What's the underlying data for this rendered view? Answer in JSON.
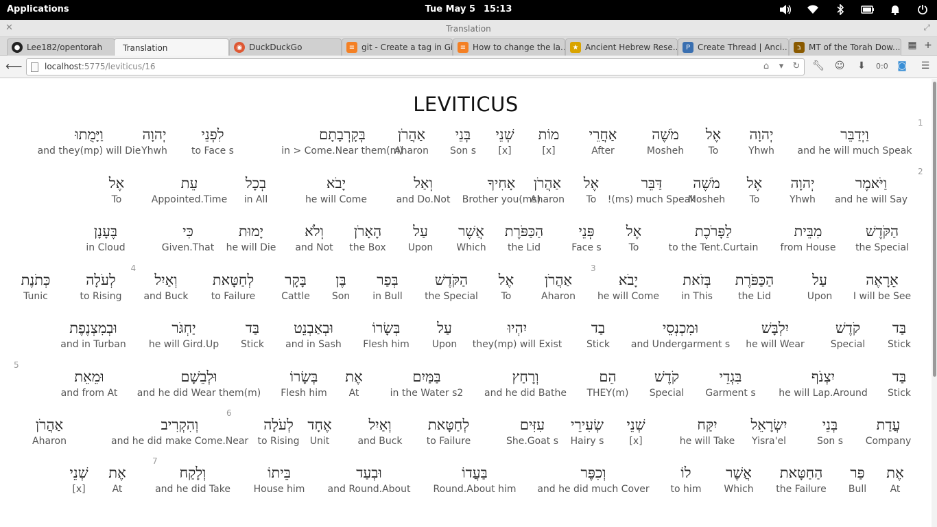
{
  "panel": {
    "applications_label": "Applications",
    "date": "Tue May  5",
    "time": "15:13",
    "icons": [
      "volume-icon",
      "wifi-icon",
      "bluetooth-icon",
      "battery-icon",
      "notifications-icon",
      "power-icon"
    ]
  },
  "window": {
    "title": "Translation"
  },
  "tabs": [
    {
      "label": "Lee182/opentorah",
      "icon": "github-icon",
      "color": "#222222",
      "active": false
    },
    {
      "label": "Translation",
      "icon": "none",
      "color": "#f6f6f6",
      "active": true
    },
    {
      "label": "DuckDuckGo",
      "icon": "duckduckgo-icon",
      "color": "#de5833",
      "active": false
    },
    {
      "label": "git - Create a tag in Gi...",
      "icon": "stackoverflow-icon",
      "color": "#f48024",
      "active": false
    },
    {
      "label": "How to change the la...",
      "icon": "stackoverflow-icon",
      "color": "#f48024",
      "active": false
    },
    {
      "label": "Ancient Hebrew Rese...",
      "icon": "star-icon",
      "color": "#d9a400",
      "active": false
    },
    {
      "label": "Create Thread | Anci...",
      "icon": "forum-icon",
      "color": "#3a6fb0",
      "active": false
    },
    {
      "label": "MT of the Torah Dow...",
      "icon": "book-icon",
      "color": "#8a5a00",
      "active": false
    }
  ],
  "url": {
    "host": "localhost",
    "path": ":5775/leviticus/16"
  },
  "toolbar": {
    "counter": "0:0"
  },
  "book_title": "LEVITICUS",
  "rows": [
    {
      "verse_marks": [
        {
          "num": "1",
          "after": 0
        }
      ],
      "words": [
        {
          "heb": "וַיְדַבֵּר",
          "eng": "and he will much Speak"
        },
        {
          "heb": "יְהוָה",
          "eng": "Yhwh"
        },
        {
          "heb": "אֶל",
          "eng": "To"
        },
        {
          "heb": "מֹשֶׁה",
          "eng": "Mosheh"
        },
        {
          "heb": "אַחֲרֵי",
          "eng": "After"
        },
        {
          "heb": "מוֹת",
          "eng": "[x]"
        },
        {
          "heb": "שְׁנֵי",
          "eng": "[x]"
        },
        {
          "heb": "בְּנֵי",
          "eng": "Son s"
        },
        {
          "heb": "אַהֲרֹן",
          "eng": "Aharon"
        },
        {
          "heb": "בְּקָרְבָתָם",
          "eng": "in > Come.Near them(m)"
        },
        {
          "heb": "לִפְנֵי",
          "eng": "to Face s"
        },
        {
          "heb": "יְהוָה",
          "eng": "Yhwh"
        },
        {
          "heb": "וַיָּמֻתוּ",
          "eng": "and they(mp) will Die"
        }
      ]
    },
    {
      "verse_marks": [
        {
          "num": "2",
          "after": 0
        }
      ],
      "words": [
        {
          "heb": "וַיֹּאמֶר",
          "eng": "and he will Say"
        },
        {
          "heb": "יְהוָה",
          "eng": "Yhwh"
        },
        {
          "heb": "אֶל",
          "eng": "To"
        },
        {
          "heb": "מֹשֶׁה",
          "eng": "Mosheh"
        },
        {
          "heb": "דַּבֵּר",
          "eng": "!(ms) much Speak"
        },
        {
          "heb": "אֶל",
          "eng": "To"
        },
        {
          "heb": "אַהֲרֹן",
          "eng": "Aharon"
        },
        {
          "heb": "אָחִיךָ",
          "eng": "Brother you(ms)"
        },
        {
          "heb": "וְאַל",
          "eng": "and Do.Not"
        },
        {
          "heb": "יָבֹא",
          "eng": "he will Come"
        },
        {
          "heb": "בְכָל",
          "eng": "in All"
        },
        {
          "heb": "עֵת",
          "eng": "Appointed.Time"
        },
        {
          "heb": "אֶל",
          "eng": "To"
        }
      ]
    },
    {
      "verse_marks": [],
      "words": [
        {
          "heb": "הַקֹּדֶשׁ",
          "eng": "the Special"
        },
        {
          "heb": "מִבֵּית",
          "eng": "from House"
        },
        {
          "heb": "לַפָּרֹכֶת",
          "eng": "to the Tent.Curtain"
        },
        {
          "heb": "אֶל",
          "eng": "To"
        },
        {
          "heb": "פְּנֵי",
          "eng": "Face s"
        },
        {
          "heb": "הַכַּפֹּרֶת",
          "eng": "the Lid"
        },
        {
          "heb": "אֲשֶׁר",
          "eng": "Which"
        },
        {
          "heb": "עַל",
          "eng": "Upon"
        },
        {
          "heb": "הָאָרֹן",
          "eng": "the Box"
        },
        {
          "heb": "וְלֹא",
          "eng": "and Not"
        },
        {
          "heb": "יָמוּת",
          "eng": "he will Die"
        },
        {
          "heb": "כִּי",
          "eng": "Given.That"
        },
        {
          "heb": "בֶּעָנָן",
          "eng": "in Cloud"
        }
      ]
    },
    {
      "verse_marks": [
        {
          "num": "3",
          "after": 5
        },
        {
          "num": "4",
          "after": 13
        }
      ],
      "words": [
        {
          "heb": "אֵרָאֶה",
          "eng": "I will be See"
        },
        {
          "heb": "עַל",
          "eng": "Upon"
        },
        {
          "heb": "הַכַּפֹּרֶת",
          "eng": "the Lid"
        },
        {
          "heb": "בְּזֹאת",
          "eng": "in This"
        },
        {
          "heb": "יָבֹא",
          "eng": "he will Come"
        },
        {
          "heb": "אַהֲרֹן",
          "eng": "Aharon"
        },
        {
          "heb": "אֶל",
          "eng": "To"
        },
        {
          "heb": "הַקֹּדֶשׁ",
          "eng": "the Special"
        },
        {
          "heb": "בְּפַר",
          "eng": "in Bull"
        },
        {
          "heb": "בֶּן",
          "eng": "Son"
        },
        {
          "heb": "בָּקָר",
          "eng": "Cattle"
        },
        {
          "heb": "לְחַטָּאת",
          "eng": "to Failure"
        },
        {
          "heb": "וְאַיִל",
          "eng": "and Buck"
        },
        {
          "heb": "לְעֹלָה",
          "eng": "to Rising"
        },
        {
          "heb": "כְּתֹנֶת",
          "eng": "Tunic"
        }
      ]
    },
    {
      "verse_marks": [],
      "words": [
        {
          "heb": "בַּד",
          "eng": "Stick"
        },
        {
          "heb": "קֹדֶשׁ",
          "eng": "Special"
        },
        {
          "heb": "יִלְבָּשׁ",
          "eng": "he will Wear"
        },
        {
          "heb": "וּמִכְנְסֵי",
          "eng": "and Undergarment s"
        },
        {
          "heb": "בַד",
          "eng": "Stick"
        },
        {
          "heb": "יִהְיוּ",
          "eng": "they(mp) will Exist"
        },
        {
          "heb": "עַל",
          "eng": "Upon"
        },
        {
          "heb": "בְּשָׂרוֹ",
          "eng": "Flesh him"
        },
        {
          "heb": "וּבְאַבְנֵט",
          "eng": "and in Sash"
        },
        {
          "heb": "בַּד",
          "eng": "Stick"
        },
        {
          "heb": "יַחְגֹּר",
          "eng": "he will Gird.Up"
        },
        {
          "heb": "וּבְמִצְנֶפֶת",
          "eng": "and in Turban"
        }
      ]
    },
    {
      "verse_marks": [
        {
          "num": "5",
          "after": 12
        }
      ],
      "words": [
        {
          "heb": "בַּד",
          "eng": "Stick"
        },
        {
          "heb": "יִצְנֹף",
          "eng": "he will Lap.Around"
        },
        {
          "heb": "בִּגְדֵי",
          "eng": "Garment s"
        },
        {
          "heb": "קֹדֶשׁ",
          "eng": "Special"
        },
        {
          "heb": "הֵם",
          "eng": "THEY(m)"
        },
        {
          "heb": "וְרָחַץ",
          "eng": "and he did Bathe"
        },
        {
          "heb": "בַּמַּיִם",
          "eng": "in the Water s2"
        },
        {
          "heb": "אֶת",
          "eng": "At"
        },
        {
          "heb": "בְּשָׂרוֹ",
          "eng": "Flesh him"
        },
        {
          "heb": "וּלְבֵשָׁם",
          "eng": "and he did Wear them(m)"
        },
        {
          "heb": "וּמֵאֵת",
          "eng": "and from At"
        }
      ]
    },
    {
      "verse_marks": [
        {
          "num": "6",
          "after": 11
        }
      ],
      "words": [
        {
          "heb": "עֲדַת",
          "eng": "Company"
        },
        {
          "heb": "בְּנֵי",
          "eng": "Son s"
        },
        {
          "heb": "יִשְׂרָאֵל",
          "eng": "Yisra'el"
        },
        {
          "heb": "יִקַּח",
          "eng": "he will Take"
        },
        {
          "heb": "שְׁנֵי",
          "eng": "[x]"
        },
        {
          "heb": "שְׂעִירֵי",
          "eng": "Hairy s"
        },
        {
          "heb": "עִזִּים",
          "eng": "She.Goat s"
        },
        {
          "heb": "לְחַטָּאת",
          "eng": "to Failure"
        },
        {
          "heb": "וְאַיִל",
          "eng": "and Buck"
        },
        {
          "heb": "אֶחָד",
          "eng": "Unit"
        },
        {
          "heb": "לְעֹלָה",
          "eng": "to Rising"
        },
        {
          "heb": "וְהִקְרִיב",
          "eng": "and he did make Come.Near"
        },
        {
          "heb": "אַהֲרֹן",
          "eng": "Aharon"
        }
      ]
    },
    {
      "verse_marks": [
        {
          "num": "7",
          "after": 10
        }
      ],
      "words": [
        {
          "heb": "אֶת",
          "eng": "At"
        },
        {
          "heb": "פַּר",
          "eng": "Bull"
        },
        {
          "heb": "הַחַטָּאת",
          "eng": "the Failure"
        },
        {
          "heb": "אֲשֶׁר",
          "eng": "Which"
        },
        {
          "heb": "לוֹ",
          "eng": "to him"
        },
        {
          "heb": "וְכִפֶּר",
          "eng": "and he did much Cover"
        },
        {
          "heb": "בַּעֲדוֹ",
          "eng": "Round.About him"
        },
        {
          "heb": "וּבְעַד",
          "eng": "and Round.About"
        },
        {
          "heb": "בֵּיתוֹ",
          "eng": "House him"
        },
        {
          "heb": "וְלָקַח",
          "eng": "and he did Take"
        },
        {
          "heb": "אֶת",
          "eng": "At"
        },
        {
          "heb": "שְׁנֵי",
          "eng": "[x]"
        }
      ]
    }
  ]
}
